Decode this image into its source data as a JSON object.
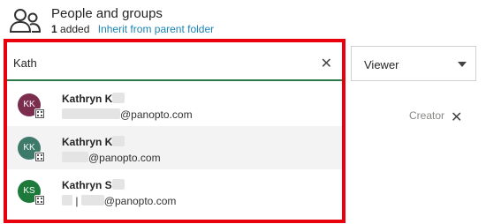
{
  "header": {
    "icon": "people-icon",
    "title": "People and groups",
    "added_count": "1",
    "added_label": "added",
    "inherit_link": "Inherit from parent folder"
  },
  "search": {
    "value": "Kath",
    "clear_icon": "close-icon"
  },
  "role_select": {
    "value": "Viewer",
    "icon": "chevron-down-icon"
  },
  "existing_row": {
    "role": "Creator",
    "remove_icon": "close-icon"
  },
  "results": [
    {
      "initials": "KK",
      "name": "Kathryn K",
      "email_suffix": "@panopto.com",
      "avatar_color": "#7b2d4e"
    },
    {
      "initials": "KK",
      "name": "Kathryn K",
      "email_suffix": "@panopto.com",
      "avatar_color": "#3d7a6a"
    },
    {
      "initials": "KS",
      "name": "Kathryn S",
      "email_suffix": "@panopto.com",
      "avatar_color": "#1d7a3a"
    }
  ],
  "colors": {
    "highlight": "#e8000d",
    "link": "#1a86b4",
    "focus_underline": "#2b7a4b"
  }
}
